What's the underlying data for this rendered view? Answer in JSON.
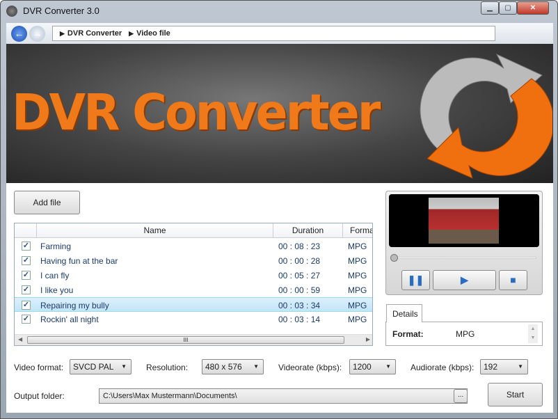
{
  "window": {
    "title": "DVR Converter 3.0",
    "minimize": "▁",
    "maximize": "▢",
    "close": "✕"
  },
  "nav": {
    "back": "←",
    "forward": "→",
    "breadcrumb": [
      "DVR Converter",
      "Video file"
    ]
  },
  "banner": {
    "logo_text": "DVR Converter"
  },
  "add_file_label": "Add file",
  "table": {
    "columns": [
      "Name",
      "Duration",
      "Format"
    ],
    "rows": [
      {
        "checked": true,
        "name": "Farming",
        "duration": "00 : 08 : 23",
        "format": "MPG"
      },
      {
        "checked": true,
        "name": "Having fun at the bar",
        "duration": "00 : 00 : 28",
        "format": "MPG"
      },
      {
        "checked": true,
        "name": "I can fly",
        "duration": "00 : 05 : 27",
        "format": "MPG"
      },
      {
        "checked": true,
        "name": "I like you",
        "duration": "00 : 00 : 59",
        "format": "MPG"
      },
      {
        "checked": true,
        "name": "Repairing my bully",
        "duration": "00 : 03 : 34",
        "format": "MPG",
        "selected": true
      },
      {
        "checked": true,
        "name": "Rockin' all night",
        "duration": "00 : 03 : 14",
        "format": "MPG"
      }
    ],
    "scroll_grip": "III"
  },
  "player": {
    "progress": 0,
    "pause": "❚❚",
    "play": "▶",
    "stop": "■"
  },
  "details": {
    "tab": "Details",
    "format_label": "Format:",
    "format_value": "MPG"
  },
  "settings": {
    "video_format_label": "Video format:",
    "video_format": "SVCD PAL",
    "resolution_label": "Resolution:",
    "resolution": "480 x 576",
    "videorate_label": "Videorate (kbps):",
    "videorate": "1200",
    "audiorate_label": "Audiorate (kbps):",
    "audiorate": "192"
  },
  "output": {
    "label": "Output folder:",
    "path": "C:\\Users\\Max Mustermann\\Documents\\",
    "browse": "...",
    "start": "Start"
  }
}
